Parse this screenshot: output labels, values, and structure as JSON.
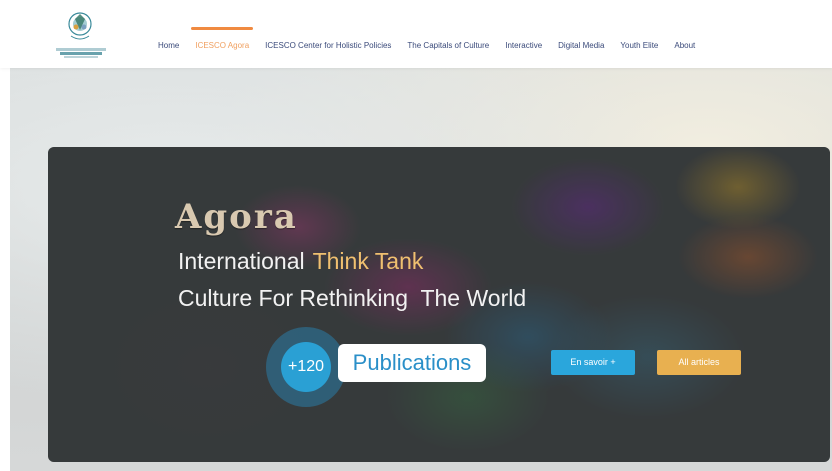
{
  "header": {
    "nav": [
      {
        "label": "Home",
        "active": false
      },
      {
        "label": "ICESCO Agora",
        "active": true
      },
      {
        "label": "ICESCO Center for Holistic Policies",
        "active": false
      },
      {
        "label": "The Capitals of Culture",
        "active": false
      },
      {
        "label": "Interactive",
        "active": false
      },
      {
        "label": "Digital Media",
        "active": false
      },
      {
        "label": "Youth Elite",
        "active": false
      },
      {
        "label": "About",
        "active": false
      }
    ]
  },
  "hero": {
    "title": "Agora",
    "line1_main": "International",
    "line1_accent": "Think Tank",
    "line2": "Culture For Rethinking  The World",
    "counter": "+120",
    "counter_label": "Publications",
    "buttons": {
      "more": "En savoir +",
      "all_articles": "All articles"
    }
  },
  "colors": {
    "nav_text": "#3a4a7a",
    "nav_active": "#f0a060",
    "accent_orange": "#f08a40",
    "publications_blue": "#2aa0d4",
    "button_blue": "#2aa6dc",
    "button_gold": "#e8b050",
    "think_tank": "#f0c070"
  },
  "icons": {
    "logo": "icesco-logo-icon"
  }
}
